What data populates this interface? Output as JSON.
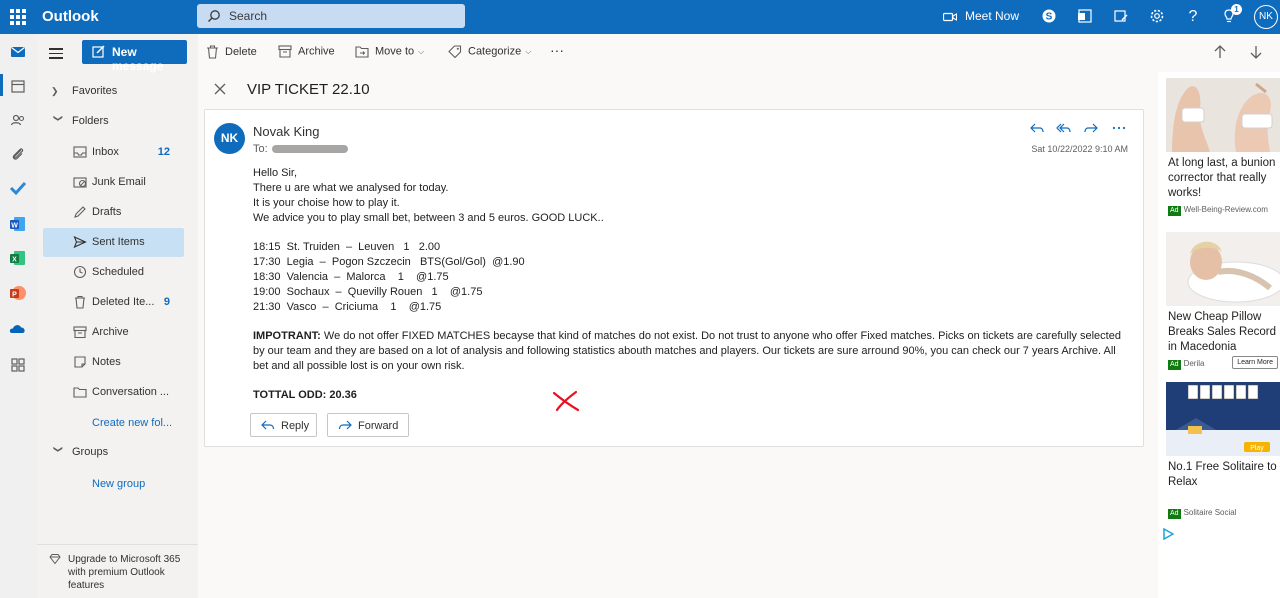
{
  "app": {
    "name": "Outlook",
    "search_placeholder": "Search",
    "meet_now": "Meet Now",
    "notification_count": "1",
    "user_initials": "NK"
  },
  "nav": {
    "new_message": "New message",
    "favorites": "Favorites",
    "folders_label": "Folders",
    "folders": [
      {
        "name": "Inbox",
        "count": "12",
        "icon": "inbox-icon"
      },
      {
        "name": "Junk Email",
        "count": "",
        "icon": "junk-icon"
      },
      {
        "name": "Drafts",
        "count": "",
        "icon": "drafts-icon"
      },
      {
        "name": "Sent Items",
        "count": "",
        "icon": "sent-icon"
      },
      {
        "name": "Scheduled",
        "count": "",
        "icon": "clock-icon"
      },
      {
        "name": "Deleted Ite...",
        "count": "9",
        "icon": "trash-icon"
      },
      {
        "name": "Archive",
        "count": "",
        "icon": "archive-icon"
      },
      {
        "name": "Notes",
        "count": "",
        "icon": "notes-icon"
      },
      {
        "name": "Conversation ...",
        "count": "",
        "icon": "folder-icon"
      }
    ],
    "active_folder": "Sent Items",
    "create_new_folder": "Create new fol...",
    "groups_label": "Groups",
    "new_group": "New group",
    "upgrade_text": "Upgrade to Microsoft 365 with premium Outlook features"
  },
  "toolbar": {
    "delete": "Delete",
    "archive": "Archive",
    "move_to": "Move to",
    "categorize": "Categorize",
    "more": "···"
  },
  "email": {
    "subject": "VIP TICKET 22.10",
    "sender_initials": "NK",
    "sender_name": "Novak King",
    "to_label": "To:",
    "datetime": "Sat 10/22/2022 9:10 AM",
    "greeting": [
      "Hello Sir,",
      "There u are what we analysed for today.",
      "It is your choise how to play it.",
      "We advice you to play small bet, between 3 and 5 euros. GOOD LUCK.."
    ],
    "matches": [
      "18:15  St. Truiden  –  Leuven   1   2.00",
      "17:30  Legia  –  Pogon Szczecin   BTS(Gol/Gol)  @1.90",
      "18:30  Valencia  –  Malorca    1    @1.75",
      "19:00  Sochaux  –  Quevilly Rouen   1    @1.75",
      "21:30  Vasco  –  Criciuma    1    @1.75"
    ],
    "notice_label": "IMPOTRANT:",
    "notice_text": " We do not offer FIXED MATCHES becayse that kind of matches do not exist. Do not trust to anyone who offer Fixed matches. Picks on tickets are carefully selected by our team and they are based on a lot of analysis and following statistics abouth matches and players. Our tickets are sure arround 90%, you can check our 7 years Archive. All bet and all possible lost is on your own risk.",
    "total": "TOTTAL ODD: 20.36",
    "reply": "Reply",
    "forward": "Forward"
  },
  "ads": [
    {
      "title": "At long last, a bunion corrector that really works!",
      "tag": "Ad",
      "source": "Well-Being-Review.com",
      "cta": ""
    },
    {
      "title": "New Cheap Pillow Breaks Sales Record in Macedonia",
      "tag": "Ad",
      "source": "Derila",
      "cta": "Learn More"
    },
    {
      "title": "No.1 Free Solitaire to Relax",
      "tag": "Ad",
      "source": "Solitaire Social",
      "cta": "",
      "image_badge": "Play"
    }
  ]
}
